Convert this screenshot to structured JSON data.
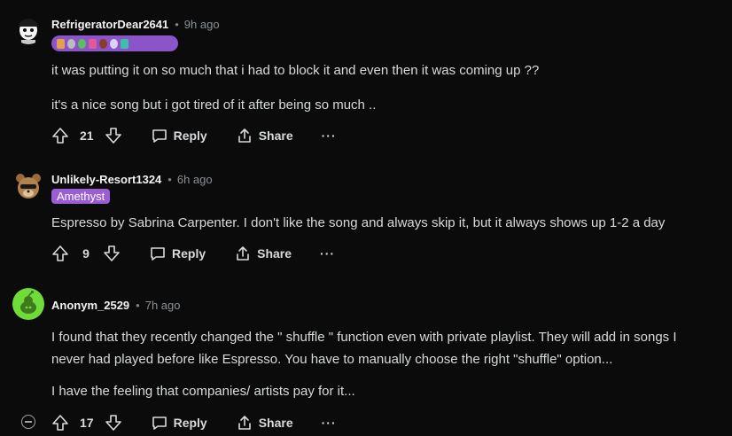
{
  "comments": [
    {
      "author": "RefrigeratorDear2641",
      "time": "9h ago",
      "flair_type": "emoji",
      "paragraphs": [
        "it was putting it on so much that i had to block it and even then it was coming up ??",
        "it's a nice song but i got tired of it after being so much .."
      ],
      "votes": "21",
      "reply_label": "Reply",
      "share_label": "Share",
      "more_label": "···"
    },
    {
      "author": "Unlikely-Resort1324",
      "time": "6h ago",
      "flair_type": "text",
      "flair": "Amethyst",
      "paragraphs": [
        "Espresso by Sabrina Carpenter. I don't like the song and always skip it, but it always shows up 1-2 a day"
      ],
      "votes": "9",
      "reply_label": "Reply",
      "share_label": "Share",
      "more_label": "···"
    },
    {
      "author": "Anonym_2529",
      "time": "7h ago",
      "flair_type": "none",
      "paragraphs": [
        "I found that they recently  changed the \" shuffle \" function even with private playlist. They will add in songs I",
        "never had played before like Espresso. You have to manually choose the right \"shuffle\" option...",
        "I have the feeling that companies/ artists pay for it..."
      ],
      "votes": "17",
      "reply_label": "Reply",
      "share_label": "Share",
      "more_label": "···"
    }
  ],
  "colors": {
    "background": "#0b0b0b",
    "flair_purple": "#9a5dd4",
    "text": "#d7dadc",
    "muted": "#8b9196"
  },
  "icons": [
    "upvote-icon",
    "downvote-icon",
    "comment-bubble-icon",
    "share-icon",
    "more-icon",
    "collapse-icon"
  ]
}
